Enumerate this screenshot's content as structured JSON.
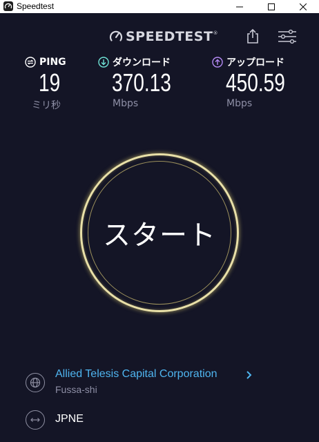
{
  "window": {
    "title": "Speedtest",
    "minimize_icon": "minimize-icon",
    "maximize_icon": "maximize-icon",
    "close_icon": "close-icon"
  },
  "header": {
    "logo_text": "SPEEDTEST",
    "logo_mark": "®",
    "share_icon": "share-icon",
    "settings_icon": "sliders-icon"
  },
  "metrics": {
    "ping": {
      "label": "PING",
      "value": "19",
      "unit": "ミリ秒",
      "icon": "ping-icon",
      "color": "#ffffff"
    },
    "download": {
      "label": "ダウンロード",
      "value": "370.13",
      "unit": "Mbps",
      "icon": "download-arrow-icon",
      "color": "#6fe3d6"
    },
    "upload": {
      "label": "アップロード",
      "value": "450.59",
      "unit": "Mbps",
      "icon": "upload-arrow-icon",
      "color": "#b58af5"
    }
  },
  "start": {
    "label": "スタート",
    "ring_color": "#e9e0a8"
  },
  "server": {
    "isp_name": "Allied Telesis Capital Corporation",
    "isp_location": "Fussa-shi",
    "host_name": "JPNE",
    "link_color": "#4fb5f0"
  }
}
